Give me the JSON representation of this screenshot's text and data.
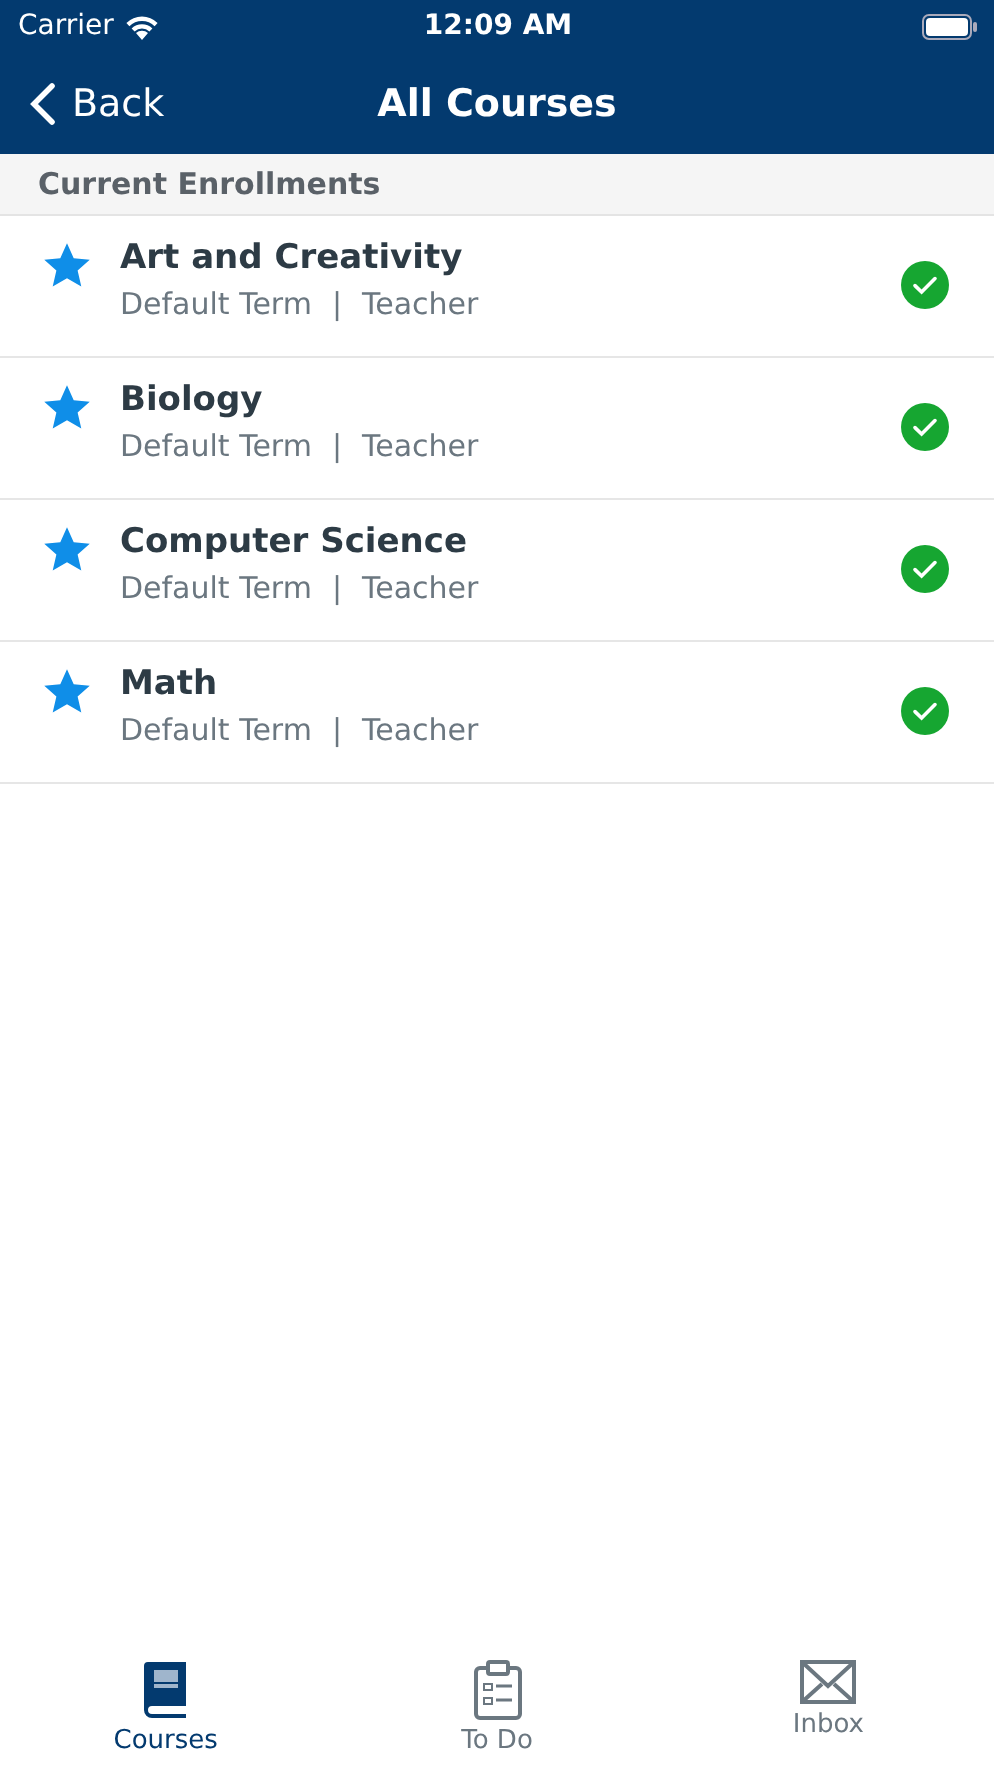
{
  "status_bar": {
    "carrier": "Carrier",
    "time": "12:09 AM"
  },
  "nav_bar": {
    "back": "Back",
    "title": "All Courses"
  },
  "section_header": "Current Enrollments",
  "courses": [
    {
      "name": "Art and Creativity",
      "term": "Default Term",
      "separator": "|",
      "role": "Teacher",
      "favorite": true,
      "published": true
    },
    {
      "name": "Biology",
      "term": "Default Term",
      "separator": "|",
      "role": "Teacher",
      "favorite": true,
      "published": true
    },
    {
      "name": "Computer Science",
      "term": "Default Term",
      "separator": "|",
      "role": "Teacher",
      "favorite": true,
      "published": true
    },
    {
      "name": "Math",
      "term": "Default Term",
      "separator": "|",
      "role": "Teacher",
      "favorite": true,
      "published": true
    }
  ],
  "tabs": [
    {
      "label": "Courses",
      "kind": "book",
      "selected": true
    },
    {
      "label": "To Do",
      "kind": "clipboard",
      "selected": false
    },
    {
      "label": "Inbox",
      "kind": "mail",
      "selected": false
    }
  ]
}
